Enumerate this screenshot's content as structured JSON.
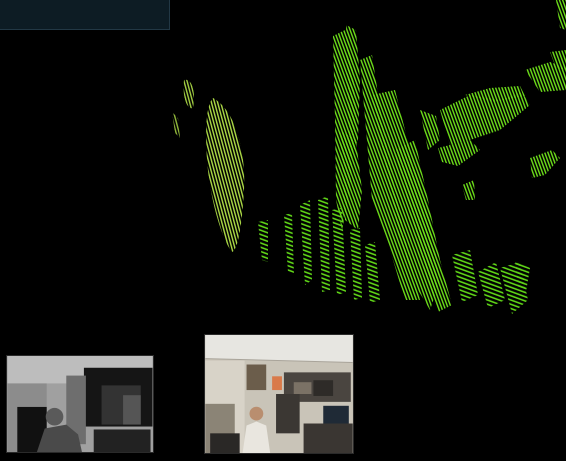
{
  "viewer": {
    "background_color": "#000000",
    "overlay_panel_color": "#0d1c24",
    "point_cloud_color": "#5bdc16",
    "point_cloud_highlight_color": "#b3e648"
  },
  "thumbnails": {
    "depth_view": {
      "kind": "grayscale depth image"
    },
    "rgb_view": {
      "kind": "color camera image"
    }
  }
}
